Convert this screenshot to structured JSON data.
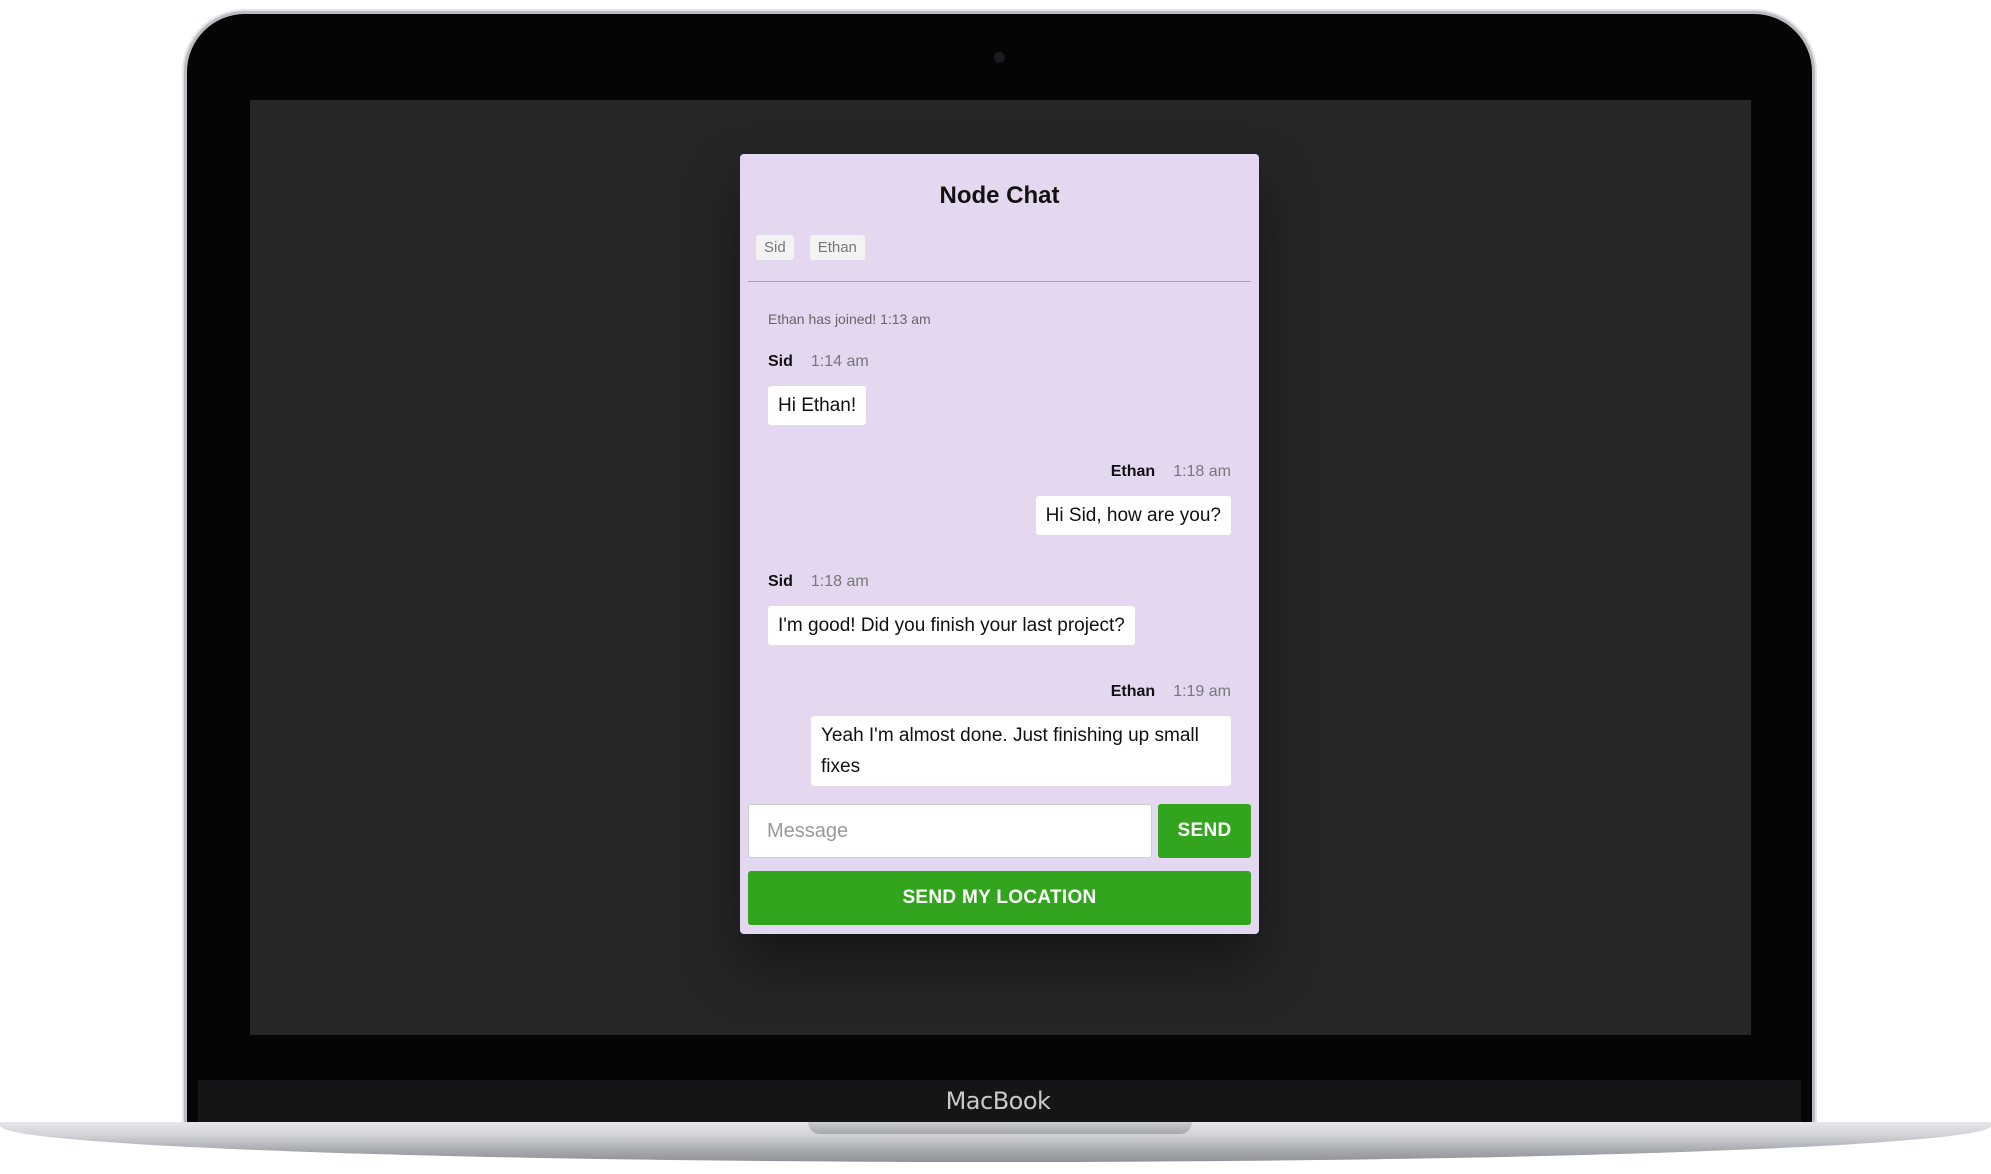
{
  "device": {
    "brand": "MacBook"
  },
  "chat": {
    "title": "Node Chat",
    "users": [
      "Sid",
      "Ethan"
    ],
    "system_message": "Ethan has joined! 1:13 am",
    "messages": [
      {
        "author": "Sid",
        "time": "1:14 am",
        "text": "Hi Ethan!",
        "side": "left"
      },
      {
        "author": "Ethan",
        "time": "1:18 am",
        "text": "Hi Sid, how are you?",
        "side": "right"
      },
      {
        "author": "Sid",
        "time": "1:18 am",
        "text": "I'm good! Did you finish your last project?",
        "side": "left"
      },
      {
        "author": "Ethan",
        "time": "1:19 am",
        "text": "Yeah I'm almost done. Just finishing up small fixes",
        "side": "right"
      }
    ]
  },
  "composer": {
    "placeholder": "Message",
    "value": "",
    "send_label": "SEND",
    "location_label": "SEND MY LOCATION"
  },
  "colors": {
    "card_background": "#e4d8f1",
    "screen_background": "#262626",
    "button_green": "#32a41d"
  }
}
